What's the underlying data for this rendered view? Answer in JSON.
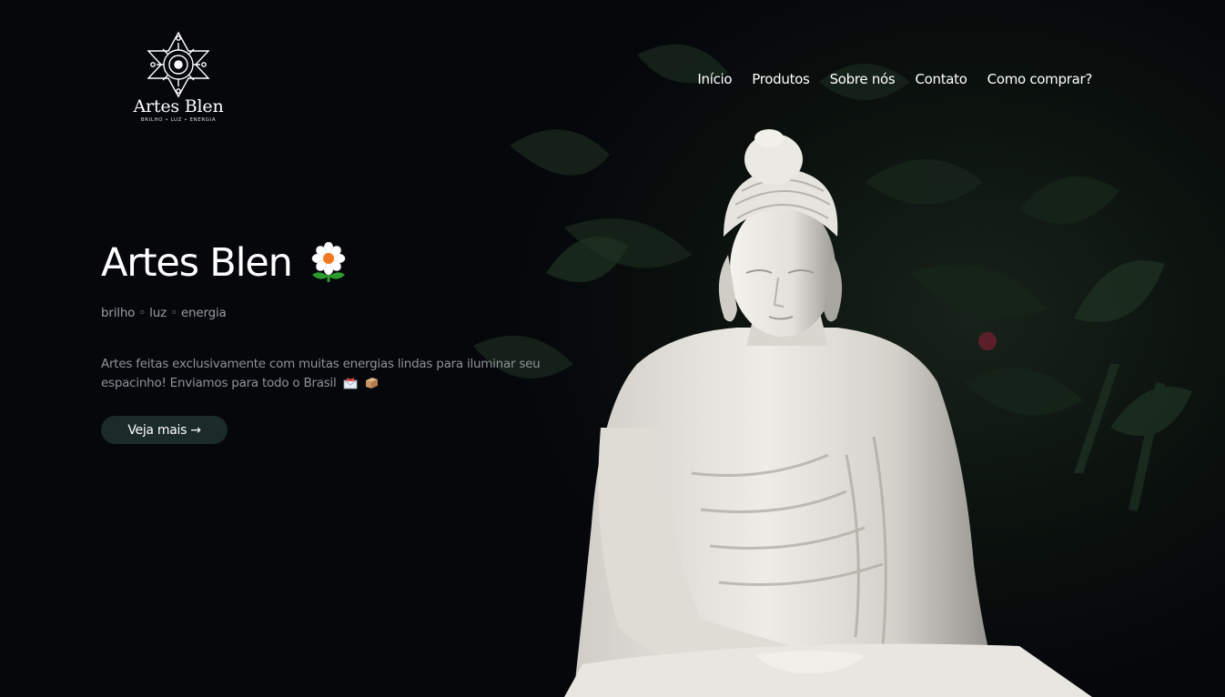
{
  "brand": {
    "logo_name": "Artes Blen",
    "logo_tagline": "BRILHO • LUZ • ENERGIA"
  },
  "nav": {
    "items": [
      "Início",
      "Produtos",
      "Sobre nós",
      "Contato",
      "Como comprar?"
    ]
  },
  "hero": {
    "title": "Artes Blen",
    "title_icon": "flower-icon",
    "subtitle": "brilho ◦ luz ◦ energia",
    "description": "Artes feitas exclusivamente com muitas energias lindas para iluminar seu espacinho! Enviamos para todo o Brasil",
    "description_icons": [
      "envelope-icon",
      "package-icon"
    ],
    "cta_label": "Veja mais →",
    "background_image": "buddha-statue-photo"
  },
  "colors": {
    "background": "#05070b",
    "button": "#1b2b29",
    "text_primary": "#ffffff",
    "text_muted": "#8f9297"
  }
}
